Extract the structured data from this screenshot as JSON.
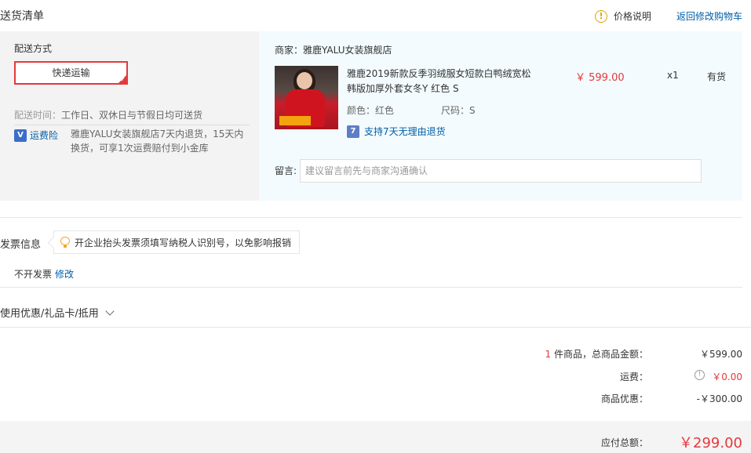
{
  "header": {
    "title": "送货清单",
    "price_note": "价格说明",
    "return_cart": "返回修改购物车"
  },
  "shipping": {
    "label": "配送方式",
    "method": "快递运输",
    "time_label": "配送时间：",
    "time_value": "工作日、双休日与节假日均可送货",
    "insurance_label": "运费险",
    "insurance_desc": "雅鹿YALU女装旗舰店7天内退货，15天内换货，可享1次运费赔付到小金库"
  },
  "order": {
    "seller": "商家：雅鹿YALU女装旗舰店",
    "product_name": "雅鹿2019新款反季羽绒服女短款白鸭绒宽松韩版加厚外套女冬Y 红色 S",
    "color": "颜色：红色",
    "size": "尺码：S",
    "return_policy": "支持7天无理由退货",
    "price": "￥ 599.00",
    "quantity": "x1",
    "stock": "有货",
    "message_label": "留言:",
    "message_placeholder": "建议留言前先与商家沟通确认"
  },
  "invoice": {
    "title": "发票信息",
    "tip": "开企业抬头发票须填写纳税人识别号，以免影响报销",
    "state": "不开发票",
    "edit": "修改"
  },
  "coupon": {
    "label": "使用优惠/礼品卡/抵用"
  },
  "summary": {
    "count": "1",
    "count_suffix": " 件商品，总商品金额：",
    "goods_total": "￥599.00",
    "freight_label": "运费：",
    "freight_value": "￥0.00",
    "discount_label": "商品优惠：",
    "discount_value": "-￥300.00",
    "payable_label": "应付总额：",
    "payable_value": "￥299.00"
  },
  "colors": {
    "accent_red": "#e4393c",
    "link_blue": "#005ea7"
  }
}
